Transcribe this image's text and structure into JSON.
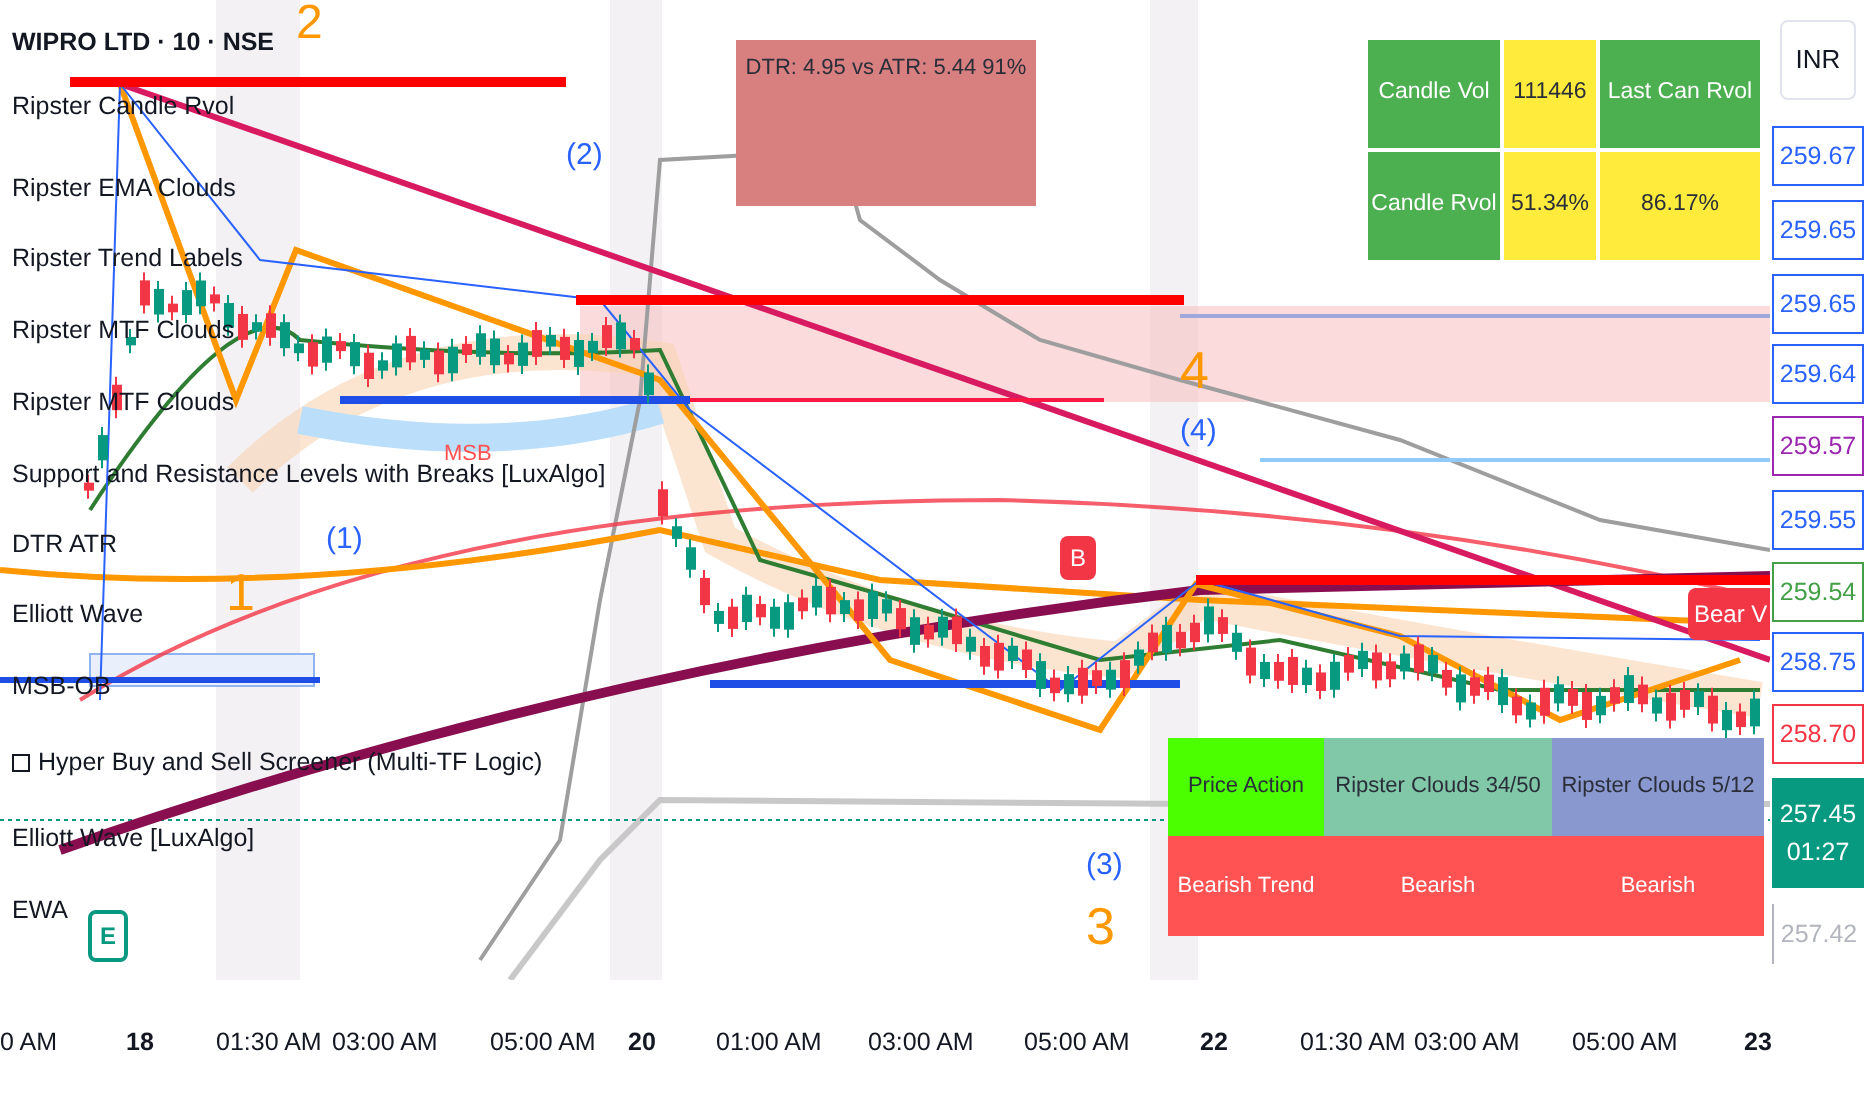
{
  "legend": [
    {
      "kind": "title",
      "text": "WIPRO LTD · 10 · NSE"
    },
    {
      "kind": "indicator",
      "text": "Ripster Candle Rvol"
    },
    {
      "kind": "indicator",
      "text": "Ripster EMA Clouds"
    },
    {
      "kind": "indicator",
      "text": "Ripster Trend Labels"
    },
    {
      "kind": "indicator",
      "text": "Ripster MTF Clouds"
    },
    {
      "kind": "indicator",
      "text": "Ripster MTF Clouds"
    },
    {
      "kind": "indicator",
      "text": "Support and Resistance Levels with Breaks [LuxAlgo]"
    },
    {
      "kind": "indicator",
      "text": "DTR ATR"
    },
    {
      "kind": "indicator",
      "text": "Elliott Wave"
    },
    {
      "kind": "indicator",
      "text": "MSB-OB"
    },
    {
      "kind": "screener",
      "text": "Hyper Buy and Sell Screener (Multi-TF Logic)"
    },
    {
      "kind": "indicator",
      "text": "Elliott Wave [LuxAlgo]"
    },
    {
      "kind": "indicator",
      "text": "EWA"
    }
  ],
  "wave_labels": [
    {
      "text": "2",
      "color": "#ff9800"
    },
    {
      "text": "(2)",
      "color": "#2962ff"
    },
    {
      "text": "4",
      "color": "#ff9800"
    },
    {
      "text": "(4)",
      "color": "#2962ff"
    },
    {
      "text": "1",
      "color": "#ff9800"
    },
    {
      "text": "(1)",
      "color": "#2962ff"
    },
    {
      "text": "(3)",
      "color": "#2962ff"
    },
    {
      "text": "3",
      "color": "#ff9800"
    },
    {
      "text": "MSB",
      "color": "#ff5252"
    }
  ],
  "badges": [
    {
      "text": "B",
      "kind": "buy"
    },
    {
      "text": "E",
      "kind": "wave"
    },
    {
      "text": "Bear V",
      "kind": "bear"
    }
  ],
  "dtr_box": {
    "text": "DTR: 4.95 vs ATR: 5.44 91%"
  },
  "rvol_table": [
    [
      {
        "text": "Candle Vol",
        "color": "#4caf50"
      },
      {
        "text": "111446",
        "color": "#ffeb3b"
      },
      {
        "text": "Last Can Rvol",
        "color": "#4caf50"
      }
    ],
    [
      {
        "text": "Candle Rvol",
        "color": "#4caf50"
      },
      {
        "text": "51.34%",
        "color": "#ffeb3b"
      },
      {
        "text": "86.17%",
        "color": "#ffeb3b"
      }
    ]
  ],
  "trend_table": [
    [
      {
        "text": "Price Action",
        "color": "#4cff00"
      },
      {
        "text": "Ripster Clouds 34/50",
        "color": "#80c8a8"
      },
      {
        "text": "Ripster Clouds 5/12",
        "color": "#8a98d0"
      }
    ],
    [
      {
        "text": "Bearish Trend",
        "color": "#ff5252"
      },
      {
        "text": "Bearish",
        "color": "#ff5252"
      },
      {
        "text": "Bearish",
        "color": "#ff5252"
      }
    ]
  ],
  "currency_button": {
    "label": "INR"
  },
  "price_labels": [
    {
      "kind": "level",
      "text": "259.67",
      "color": "#2962ff"
    },
    {
      "kind": "level",
      "text": "259.65",
      "color": "#2962ff"
    },
    {
      "kind": "level",
      "text": "259.65",
      "color": "#2962ff"
    },
    {
      "kind": "level",
      "text": "259.64",
      "color": "#2962ff"
    },
    {
      "kind": "level",
      "text": "259.57",
      "color": "#9c27b0"
    },
    {
      "kind": "level",
      "text": "259.55",
      "color": "#2962ff"
    },
    {
      "kind": "level",
      "text": "259.54",
      "color": "#43a047"
    },
    {
      "kind": "level",
      "text": "258.75",
      "color": "#2962ff"
    },
    {
      "kind": "level",
      "text": "258.70",
      "color": "#f23645"
    },
    {
      "kind": "current",
      "text": "257.45",
      "countdown": "01:27",
      "color": "#089981"
    },
    {
      "kind": "scale",
      "text": "257.42",
      "color": "#b2b5be"
    }
  ],
  "time_axis": [
    {
      "text": "0 AM",
      "bold": false
    },
    {
      "text": "18",
      "bold": true
    },
    {
      "text": "01:30 AM",
      "bold": false
    },
    {
      "text": "03:00 AM",
      "bold": false
    },
    {
      "text": "05:00 AM",
      "bold": false
    },
    {
      "text": "20",
      "bold": true
    },
    {
      "text": "01:00 AM",
      "bold": false
    },
    {
      "text": "03:00 AM",
      "bold": false
    },
    {
      "text": "05:00 AM",
      "bold": false
    },
    {
      "text": "22",
      "bold": true
    },
    {
      "text": "01:30 AM",
      "bold": false
    },
    {
      "text": "03:00 AM",
      "bold": false
    },
    {
      "text": "05:00 AM",
      "bold": false
    },
    {
      "text": "23",
      "bold": true
    }
  ]
}
